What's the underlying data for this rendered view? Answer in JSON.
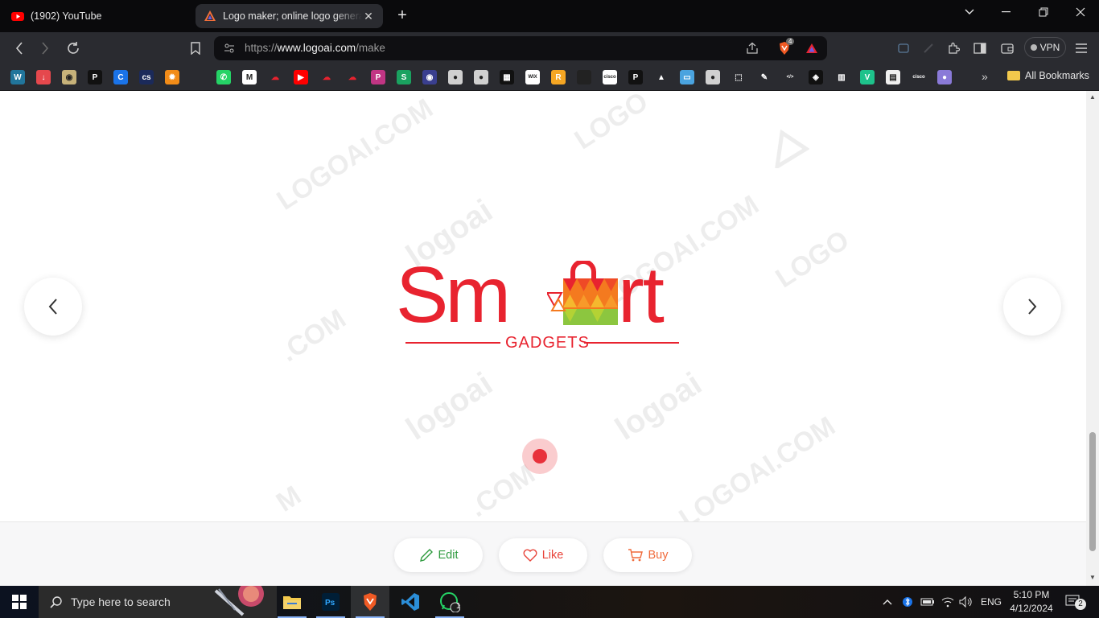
{
  "browser": {
    "tabs": [
      {
        "title": "(1902) YouTube",
        "favicon": "youtube-icon",
        "active": false
      },
      {
        "title": "Logo maker; online logo genera",
        "favicon": "logoai-icon",
        "active": true
      }
    ],
    "url": {
      "scheme": "https://",
      "host": "www.logoai.com",
      "path": "/make"
    },
    "vpn_label": "VPN",
    "brave_badge": "4",
    "all_bookmarks_label": "All Bookmarks",
    "bookmarks": [
      {
        "icon": "wordpress-icon",
        "color": "#21759b",
        "glyph": "W"
      },
      {
        "icon": "download-icon",
        "color": "#e5484d",
        "glyph": "↓"
      },
      {
        "icon": "emblem-icon",
        "color": "#c7b27a",
        "glyph": "◉"
      },
      {
        "icon": "p-icon",
        "color": "#111111",
        "glyph": "P"
      },
      {
        "icon": "c-icon",
        "color": "#1a73e8",
        "glyph": "C"
      },
      {
        "icon": "cs-icon",
        "color": "#1b2a5a",
        "glyph": "cs"
      },
      {
        "icon": "gear-orange-icon",
        "color": "#f28c18",
        "glyph": "✹"
      },
      {
        "icon": "blank-icon",
        "color": "#2a2b30",
        "glyph": ""
      },
      {
        "icon": "whatsapp-icon",
        "color": "#25d366",
        "glyph": "✆"
      },
      {
        "icon": "gmail-icon",
        "color": "#ffffff",
        "glyph": "M"
      },
      {
        "icon": "cloud-red-icon",
        "color": "#2a2b30",
        "glyph": "☁"
      },
      {
        "icon": "youtube-icon",
        "color": "#ff0000",
        "glyph": "▶"
      },
      {
        "icon": "cloud-red-icon",
        "color": "#2a2b30",
        "glyph": "☁"
      },
      {
        "icon": "cloud-red-icon",
        "color": "#2a2b30",
        "glyph": "☁"
      },
      {
        "icon": "picsart-icon",
        "color": "#c13584",
        "glyph": "P"
      },
      {
        "icon": "s-green-icon",
        "color": "#1aa260",
        "glyph": "S"
      },
      {
        "icon": "eye-icon",
        "color": "#3a3f8f",
        "glyph": "◉"
      },
      {
        "icon": "globe-icon",
        "color": "#d0d0d0",
        "glyph": "●"
      },
      {
        "icon": "globe-icon",
        "color": "#d0d0d0",
        "glyph": "●"
      },
      {
        "icon": "qr-icon",
        "color": "#111111",
        "glyph": "▦"
      },
      {
        "icon": "wix-icon",
        "color": "#ffffff",
        "glyph": "WIX"
      },
      {
        "icon": "r-icon",
        "color": "#f5a623",
        "glyph": "R"
      },
      {
        "icon": "dark-icon",
        "color": "#222222",
        "glyph": ""
      },
      {
        "icon": "cisco-icon",
        "color": "#ffffff",
        "glyph": "cisco"
      },
      {
        "icon": "p-white-icon",
        "color": "#111111",
        "glyph": "P"
      },
      {
        "icon": "triangle-icon",
        "color": "#2a2b30",
        "glyph": "▲"
      },
      {
        "icon": "window-icon",
        "color": "#4aa3df",
        "glyph": "▭"
      },
      {
        "icon": "globe-icon",
        "color": "#d0d0d0",
        "glyph": "●"
      },
      {
        "icon": "box-icon",
        "color": "#2a2b30",
        "glyph": "⬚"
      },
      {
        "icon": "pencil-icon",
        "color": "#2a2b30",
        "glyph": "✎"
      },
      {
        "icon": "code-icon",
        "color": "#2a2b30",
        "glyph": "</>"
      },
      {
        "icon": "diamond-icon",
        "color": "#111111",
        "glyph": "◈"
      },
      {
        "icon": "chart-icon",
        "color": "#2a2b30",
        "glyph": "▥"
      },
      {
        "icon": "v-icon",
        "color": "#1ec28b",
        "glyph": "V"
      },
      {
        "icon": "page-icon",
        "color": "#f0f0f0",
        "glyph": "▤"
      },
      {
        "icon": "cisco-gray-icon",
        "color": "#2a2b30",
        "glyph": "cisco"
      },
      {
        "icon": "orb-icon",
        "color": "#8a7ad8",
        "glyph": "●"
      }
    ]
  },
  "logo": {
    "word_left": "Sm",
    "word_right": "rt",
    "tagline": "GADGETS",
    "brand_color": "#e8232f",
    "bag_colors": [
      "#e8232f",
      "#f47a1f",
      "#f5b82e",
      "#8cc63f"
    ]
  },
  "watermarks": {
    "text_domain": "LOGOAI.COM",
    "text_brand": "logoai",
    "text_short": "LOGO",
    "text_com": ".COM",
    "text_m": "M"
  },
  "actions": {
    "edit_label": "Edit",
    "like_label": "Like",
    "buy_label": "Buy",
    "edit_color": "#2e9a3e",
    "like_color": "#e8443a",
    "buy_color": "#f06a3a"
  },
  "taskbar": {
    "search_placeholder": "Type here to search",
    "language": "ENG",
    "time": "5:10 PM",
    "date": "4/12/2024",
    "notification_count": "2",
    "whatsapp_badge": "1"
  }
}
